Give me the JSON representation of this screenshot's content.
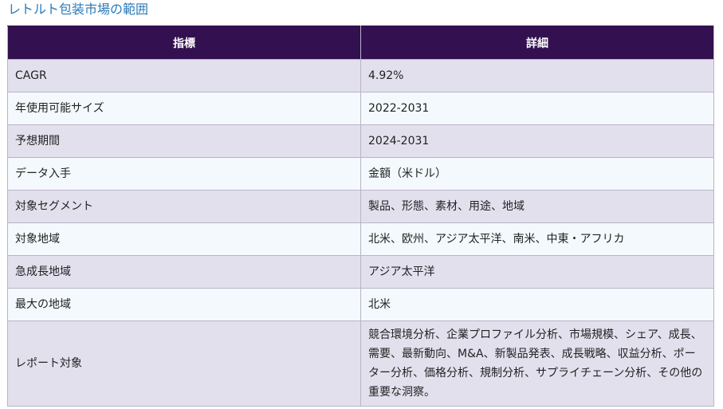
{
  "title": "レトルト包装市場の範囲",
  "table": {
    "headers": [
      "指標",
      "詳細"
    ],
    "rows": [
      {
        "label": "CAGR",
        "value": "4.92%"
      },
      {
        "label": "年使用可能サイズ",
        "value": "2022-2031"
      },
      {
        "label": "予想期間",
        "value": "2024-2031"
      },
      {
        "label": "データ入手",
        "value": "金額（米ドル）"
      },
      {
        "label": "対象セグメント",
        "value": "製品、形態、素材、用途、地域"
      },
      {
        "label": "対象地域",
        "value": "北米、欧州、アジア太平洋、南米、中東・アフリカ"
      },
      {
        "label": "急成長地域",
        "value": "アジア太平洋"
      },
      {
        "label": "最大の地域",
        "value": "北米"
      },
      {
        "label": "レポート対象",
        "value": "競合環境分析、企業プロファイル分析、市場規模、シェア、成長、需要、最新動向、M&A、新製品発表、成長戦略、収益分析、ポーター分析、価格分析、規制分析、サプライチェーン分析、その他の重要な洞察。"
      }
    ]
  },
  "colors": {
    "title": "#2a7ab8",
    "header_bg": "#33104f",
    "row_odd": "#e3e0ee",
    "row_even": "#f3f9fc"
  }
}
